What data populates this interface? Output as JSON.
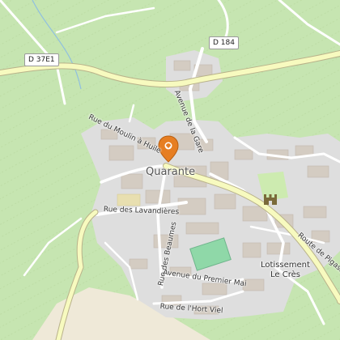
{
  "map": {
    "place_name": "Quarante",
    "locality": [
      "Lotissement",
      "Le Crès"
    ],
    "road_shields": [
      "D 184",
      "D 37E1"
    ],
    "street_labels": [
      "Rue du Moulin à Huile",
      "Avenue de la Gare",
      "Rue des Lavandières",
      "Route de Pigasse",
      "Rue des Beaumes",
      "Avenue du Premier Mai",
      "Rue de l'Hort Viel"
    ],
    "icons": [
      "location-pin-icon",
      "castle-icon"
    ],
    "colors": {
      "vineyard": "#c6e5b1",
      "residential": "#dedede",
      "building": "#d4ccc2",
      "road": "#ffffff",
      "primary_road": "#f7fabf",
      "pin": "#e67e22",
      "pitch": "#8fd8a8",
      "park": "#cdebb0"
    }
  }
}
